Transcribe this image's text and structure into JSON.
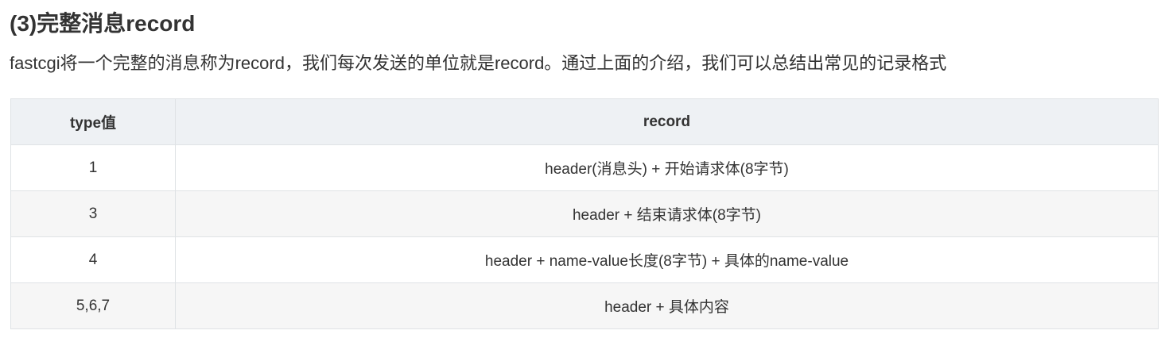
{
  "heading": "(3)完整消息record",
  "paragraph": "fastcgi将一个完整的消息称为record，我们每次发送的单位就是record。通过上面的介绍，我们可以总结出常见的记录格式",
  "table": {
    "headers": [
      "type值",
      "record"
    ],
    "rows": [
      {
        "type": "1",
        "record": "header(消息头) + 开始请求体(8字节)"
      },
      {
        "type": "3",
        "record": "header + 结束请求体(8字节)"
      },
      {
        "type": "4",
        "record": "header + name-value长度(8字节) + 具体的name-value"
      },
      {
        "type": "5,6,7",
        "record": "header + 具体内容"
      }
    ]
  }
}
